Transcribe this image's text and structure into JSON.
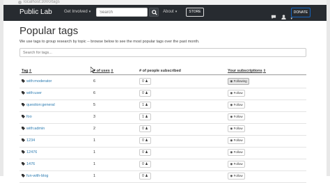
{
  "browser": {
    "url": "localhost:3000/tags"
  },
  "navbar": {
    "brand": "Public Lab",
    "get_involved": "Get Involved",
    "search_placeholder": "Search",
    "about": "About",
    "store": "STORE",
    "donate": "DONATE",
    "icons": [
      "search-icon",
      "chat-icon",
      "user-icon",
      "caret-icon"
    ]
  },
  "page": {
    "title": "Popular tags",
    "description": "We use tags to group research by topic -- browse below to see the most popular tags over the past month.",
    "filter_placeholder": "Search for tags..."
  },
  "table": {
    "headers": {
      "tag": "Tag",
      "uses": "# of uses",
      "people": "# of people subscribed",
      "subscriptions": "Your subscriptions"
    },
    "rows": [
      {
        "tag": "with:moderator",
        "uses": "6",
        "subs": "0",
        "action": "Following"
      },
      {
        "tag": "with:user",
        "uses": "6",
        "subs": "0",
        "action": "Follow"
      },
      {
        "tag": "question:general",
        "uses": "5",
        "subs": "1",
        "action": "Follow"
      },
      {
        "tag": "foo",
        "uses": "3",
        "subs": "1",
        "action": "Follow"
      },
      {
        "tag": "with:admin",
        "uses": "2",
        "subs": "0",
        "action": "Follow"
      },
      {
        "tag": "1234",
        "uses": "1",
        "subs": "0",
        "action": "Follow"
      },
      {
        "tag": "12476",
        "uses": "1",
        "subs": "0",
        "action": "Follow"
      },
      {
        "tag": "1476",
        "uses": "1",
        "subs": "0",
        "action": "Follow"
      },
      {
        "tag": "fun-with-blog",
        "uses": "1",
        "subs": "0",
        "action": "Follow"
      }
    ]
  },
  "colors": {
    "navbar": "#272b30",
    "link": "#2a7ab0",
    "donate_border": "#1565c0"
  }
}
